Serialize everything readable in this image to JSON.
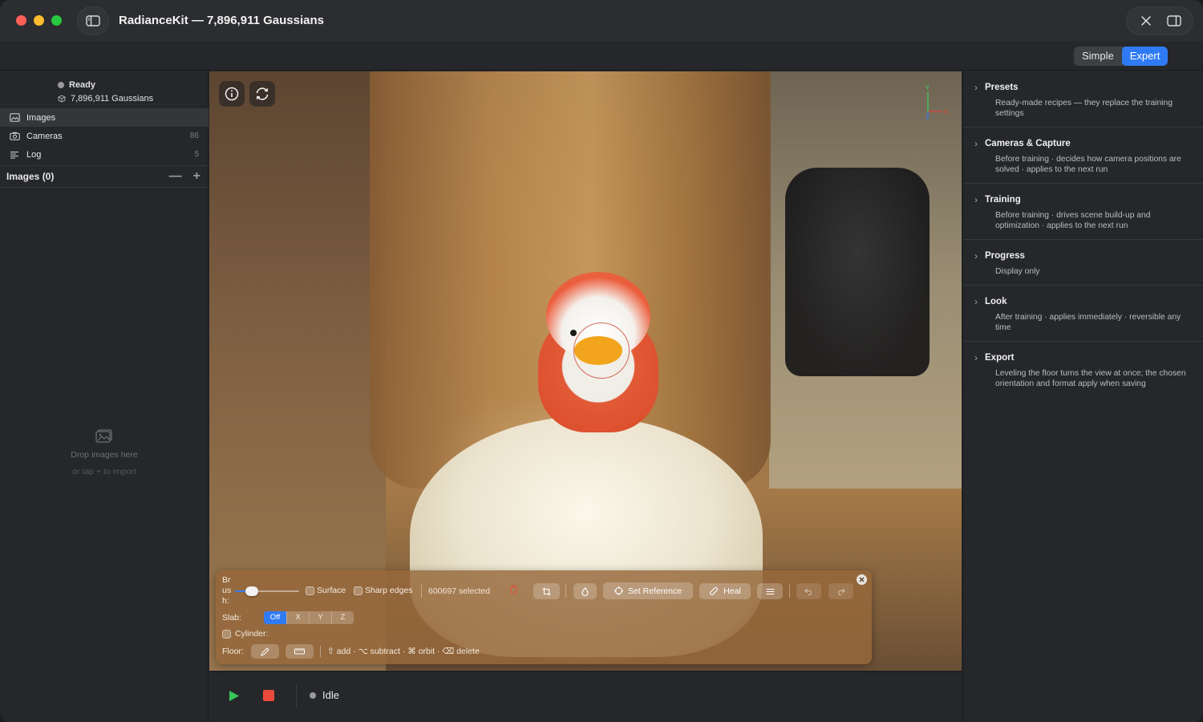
{
  "window": {
    "title": "RadianceKit — 7,896,911 Gaussians"
  },
  "mode": {
    "options": [
      "Simple",
      "Expert"
    ],
    "selected": "Expert"
  },
  "status": {
    "state": "Ready",
    "gaussians": "7,896,911 Gaussians"
  },
  "sidebar": {
    "items": [
      {
        "label": "Images",
        "count": "",
        "icon": "image-stack-icon",
        "selected": true
      },
      {
        "label": "Cameras",
        "count": "86",
        "icon": "camera-icon",
        "selected": false
      },
      {
        "label": "Log",
        "count": "5",
        "icon": "log-lines-icon",
        "selected": false
      }
    ],
    "section_title": "Images (0)",
    "drop_hint": "Drop images here",
    "drop_sub": "or tap + to import"
  },
  "edit_panel": {
    "brush_label": "Brush:",
    "brush_level": 0.2,
    "surface_label": "Surface",
    "sharp_edges_label": "Sharp edges",
    "selected_text": "600697 selected",
    "set_reference_label": "Set Reference",
    "heal_label": "Heal",
    "slab_label": "Slab:",
    "slab_options": [
      "Off",
      "X",
      "Y",
      "Z"
    ],
    "slab_selected": "Off",
    "cylinder_label": "Cylinder:",
    "floor_label": "Floor:",
    "shortcuts_hint": "⇧ add · ⌥ subtract · ⌘ orbit · ⌫ delete"
  },
  "bottom": {
    "state": "Idle"
  },
  "inspector": {
    "sections": [
      {
        "title": "Presets",
        "desc": "Ready-made recipes — they replace the training settings"
      },
      {
        "title": "Cameras & Capture",
        "desc": "Before training · decides how camera positions are solved · applies to the next run"
      },
      {
        "title": "Training",
        "desc": "Before training · drives scene build-up and optimization · applies to the next run"
      },
      {
        "title": "Progress",
        "desc": "Display only"
      },
      {
        "title": "Look",
        "desc": "After training · applies immediately · reversible any time"
      },
      {
        "title": "Export",
        "desc": "Leveling the floor turns the view at once; the chosen orientation and format apply when saving"
      }
    ]
  },
  "gizmo": {
    "x_label": "X",
    "y_label": "Y",
    "z_label": "Z"
  },
  "colors": {
    "accent": "#2f7bf5",
    "stop": "#ea4a3a",
    "play": "#34c759"
  }
}
